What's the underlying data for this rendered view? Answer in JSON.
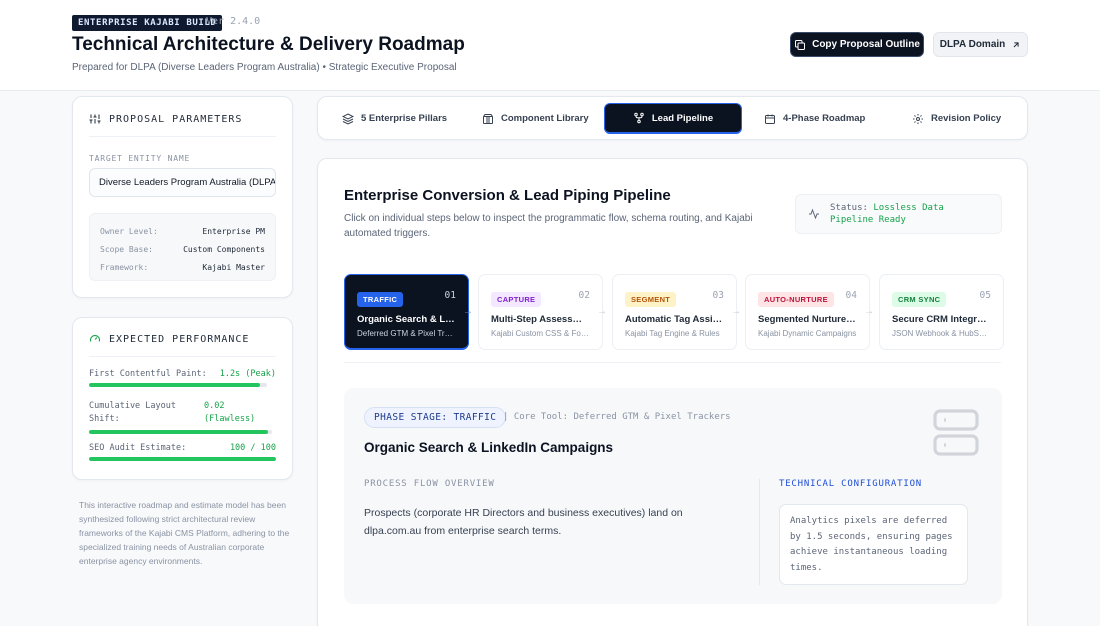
{
  "header": {
    "build_badge": "ENTERPRISE KAJABI BUILD",
    "version": "Ver 2.4.0",
    "title": "Technical Architecture & Delivery Roadmap",
    "subtitle": "Prepared for DLPA (Diverse Leaders Program Australia) • Strategic Executive Proposal",
    "copy_button": "Copy Proposal Outline",
    "domain_button": "DLPA Domain"
  },
  "params": {
    "heading": "PROPOSAL PARAMETERS",
    "entity_label": "TARGET ENTITY NAME",
    "entity_value": "Diverse Leaders Program Australia (DLPA)",
    "rows": [
      {
        "key": "Owner Level:",
        "value": "Enterprise PM"
      },
      {
        "key": "Scope Base:",
        "value": "Custom Components"
      },
      {
        "key": "Framework:",
        "value": "Kajabi Master"
      }
    ]
  },
  "performance": {
    "heading": "EXPECTED PERFORMANCE",
    "metrics": [
      {
        "label": "First Contentful Paint:",
        "value": "1.2s (Peak)",
        "fill": 0.96
      },
      {
        "label": "Cumulative Layout Shift:",
        "label_line1": "Cumulative Layout",
        "label_line2": "Shift:",
        "value_line1": "0.02",
        "value_line2": "(Flawless)",
        "fill": 0.98
      },
      {
        "label": "SEO Audit Estimate:",
        "value": "100 / 100",
        "fill": 1.0
      }
    ]
  },
  "footnote": "This interactive roadmap and estimate model has been synthesized following strict architectural review frameworks of the Kajabi CMS Platform, adhering to the specialized training needs of Australian corporate enterprise agency environments.",
  "tabs": [
    {
      "label": "5 Enterprise Pillars",
      "icon": "layers-icon"
    },
    {
      "label": "Component Library",
      "icon": "package-icon"
    },
    {
      "label": "Lead Pipeline",
      "icon": "git-fork-icon",
      "active": true
    },
    {
      "label": "4-Phase Roadmap",
      "icon": "calendar-icon"
    },
    {
      "label": "Revision Policy",
      "icon": "settings-icon"
    }
  ],
  "pipeline": {
    "title": "Enterprise Conversion & Lead Piping Pipeline",
    "description": "Click on individual steps below to inspect the programmatic flow, schema routing, and Kajabi automated triggers.",
    "status_key": "Status:",
    "status_value_line1": "Lossless Data",
    "status_value_line2": "Pipeline Ready",
    "steps": [
      {
        "tag": "TRAFFIC",
        "num": "01",
        "name": "Organic Search & LinkedIn Campaigns",
        "sub": "Deferred GTM & Pixel Trackers",
        "tag_bg": "#2563eb",
        "tag_fg": "#ffffff",
        "active": true
      },
      {
        "tag": "CAPTURE",
        "num": "02",
        "name": "Multi-Step Assessment Forms",
        "sub": "Kajabi Custom CSS & Forms",
        "tag_bg": "#f3e8ff",
        "tag_fg": "#7e22ce"
      },
      {
        "tag": "SEGMENT",
        "num": "03",
        "name": "Automatic Tag Assignment",
        "sub": "Kajabi Tag Engine & Rules",
        "tag_bg": "#fef3c7",
        "tag_fg": "#b45309"
      },
      {
        "tag": "AUTO-NURTURE",
        "num": "04",
        "name": "Segmented Nurture Sequences",
        "sub": "Kajabi Dynamic Campaigns",
        "tag_bg": "#ffe4e6",
        "tag_fg": "#be123c"
      },
      {
        "tag": "CRM SYNC",
        "num": "05",
        "name": "Secure CRM Integration",
        "sub": "JSON Webhook & HubSpot Sync",
        "tag_bg": "#dcfce7",
        "tag_fg": "#15803d"
      }
    ],
    "detail": {
      "phase_pill": "PHASE STAGE: TRAFFIC",
      "core_tool": "| Core Tool: Deferred GTM & Pixel Trackers",
      "title": "Organic Search & LinkedIn Campaigns",
      "flow_label": "PROCESS FLOW OVERVIEW",
      "flow_text": "Prospects (corporate HR Directors and business executives) land on dlpa.com.au from enterprise search terms.",
      "tech_label": "TECHNICAL CONFIGURATION",
      "tech_text": "Analytics pixels are deferred by 1.5 seconds, ensuring pages achieve instantaneous loading times."
    }
  }
}
